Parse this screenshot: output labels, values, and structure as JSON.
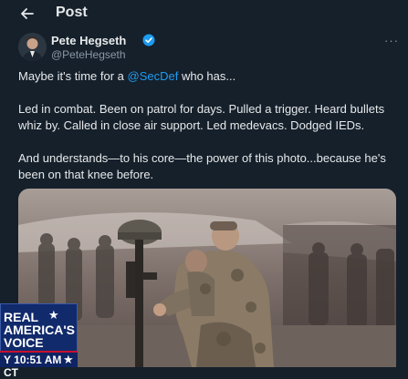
{
  "header": {
    "back_icon": "arrow-left-icon",
    "title": "Post"
  },
  "author": {
    "name": "Pete Hegseth",
    "handle": "@PeteHegseth",
    "verified_icon": "verified-badge-icon",
    "verified_color": "#1d9bf0"
  },
  "more_icon": "more-horizontal-icon",
  "tweet": {
    "line1_prefix": "Maybe it's time for a ",
    "mention": "@SecDef",
    "line1_suffix": " who has...",
    "para2": "Led in combat. Been on patrol for days. Pulled a trigger. Heard bullets whiz by. Called in close air support. Led medevacs. Dodged IEDs.",
    "para3": "And understands—to his core—the power of this photo...because he's been on that knee before."
  },
  "media": {
    "description_icon": "photo-soldier-kneeling-battle-cross"
  },
  "overlay": {
    "logo_line1": "REAL",
    "logo_line2": "AMERICA'S",
    "logo_line3": "VOICE",
    "logo_icon": "star-icon",
    "time_prefix": "Y",
    "time": "10:51 AM CT",
    "time_icon": "star-icon",
    "colors": {
      "navy": "#112a6b",
      "red": "#c8102e"
    }
  }
}
